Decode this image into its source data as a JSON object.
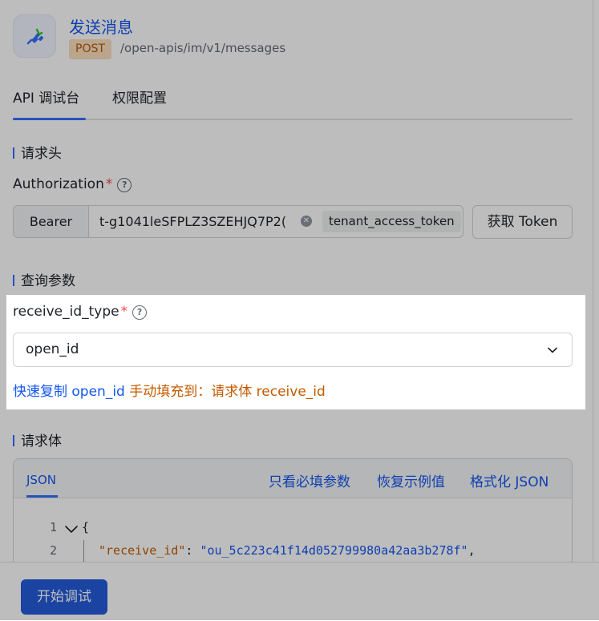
{
  "header": {
    "title": "发送消息",
    "method": "POST",
    "path": "/open-apis/im/v1/messages",
    "icon": "plug-icon"
  },
  "tabs": [
    {
      "label": "API 调试台",
      "active": true
    },
    {
      "label": "权限配置",
      "active": false
    }
  ],
  "sections": {
    "headers_title": "请求头",
    "query_title": "查询参数",
    "body_title": "请求体"
  },
  "authorization": {
    "label": "Authorization",
    "required_mark": "*",
    "help": "?",
    "scheme": "Bearer",
    "value": "t-g1041leSFPLZ3SZEHJQ7P2(",
    "token_type": "tenant_access_token",
    "get_token_label": "获取 Token"
  },
  "query": {
    "field_label": "receive_id_type",
    "required_mark": "*",
    "help": "?",
    "selected": "open_id",
    "hint_prefix": "快速复制 open_id",
    "hint_suffix": " 手动填充到：请求体 receive_id"
  },
  "body": {
    "tab_label": "JSON",
    "actions": [
      "只看必填参数",
      "恢复示例值",
      "格式化 JSON"
    ],
    "lines": [
      {
        "number": "1",
        "text": "{"
      },
      {
        "number": "2",
        "key": "\"receive_id\"",
        "sep": ": ",
        "value": "\"ou_5c223c41f14d052799980a42aa3b278f\"",
        "tail": ","
      }
    ]
  },
  "footer": {
    "start_label": "开始调试"
  },
  "colors": {
    "accent": "#3370ff",
    "link": "#1456f0",
    "required": "#f54a45",
    "hint_orange": "#c35a00",
    "method_bg": "#fcdfbf"
  }
}
